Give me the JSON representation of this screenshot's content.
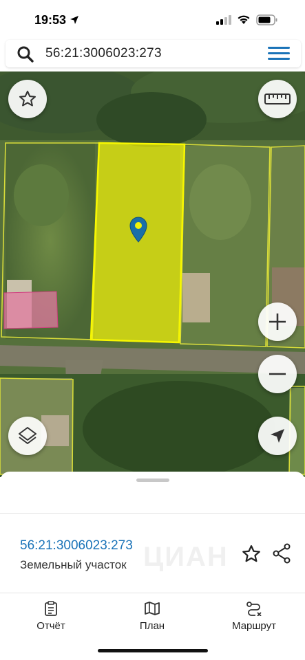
{
  "status_bar": {
    "time": "19:53"
  },
  "search": {
    "query": "56:21:3006023:273"
  },
  "map": {
    "selected_parcel_color": "#f2f20a",
    "neighbor_border_color": "#d8dc3a",
    "building_highlight_color": "#e07aa0"
  },
  "sheet": {
    "parcel_number": "56:21:3006023:273",
    "parcel_type": "Земельный участок",
    "watermark": "ЦИАН"
  },
  "tabs": [
    {
      "label": "Отчёт",
      "icon": "report-icon"
    },
    {
      "label": "План",
      "icon": "map-plan-icon"
    },
    {
      "label": "Маршрут",
      "icon": "route-icon"
    }
  ],
  "colors": {
    "accent": "#1a73b8"
  }
}
